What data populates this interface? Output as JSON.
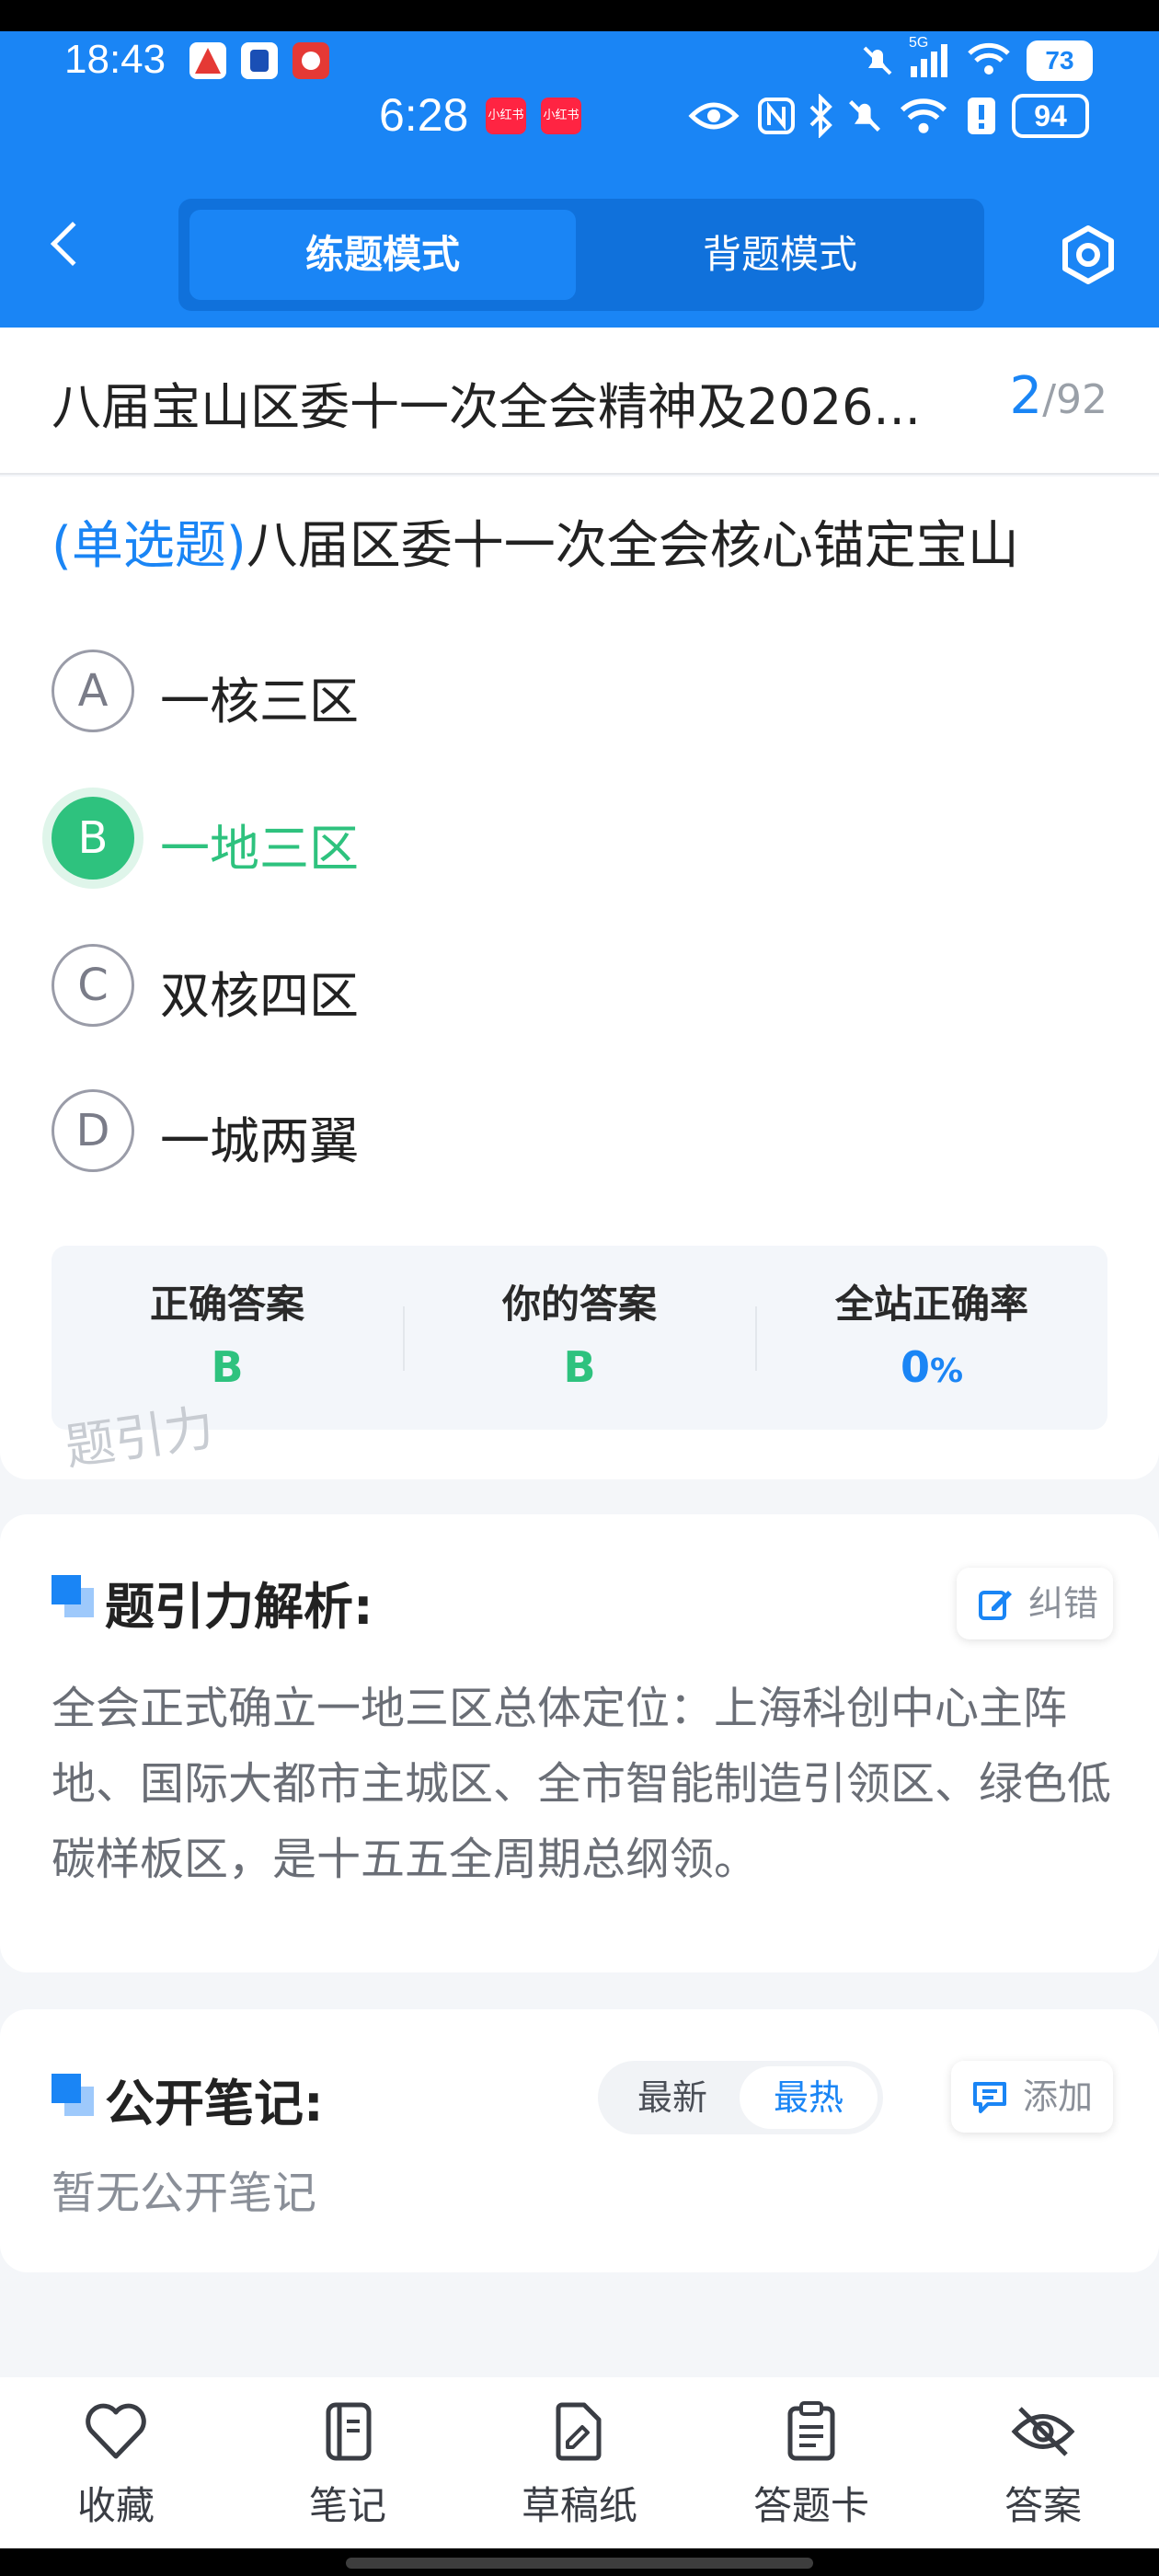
{
  "status_bar": {
    "time_primary": "18:43",
    "time_secondary": "6:28",
    "battery_primary": "73",
    "battery_secondary": "94",
    "network_label": "5G",
    "xhs_label": "小红书"
  },
  "nav": {
    "tab_practice": "练题模式",
    "tab_memorize": "背题模式"
  },
  "header": {
    "title": "八届宝山区委十一次全会精神及2026...",
    "current": "2",
    "total": "/92"
  },
  "question": {
    "type_label": "(单选题)",
    "text": "八届区委十一次全会核心锚定宝山",
    "options": [
      {
        "letter": "A",
        "text": "一核三区"
      },
      {
        "letter": "B",
        "text": "一地三区"
      },
      {
        "letter": "C",
        "text": "双核四区"
      },
      {
        "letter": "D",
        "text": "一城两翼"
      }
    ],
    "selected": "B"
  },
  "result": {
    "correct_label": "正确答案",
    "correct_value": "B",
    "yours_label": "你的答案",
    "yours_value": "B",
    "rate_label": "全站正确率",
    "rate_value": "0",
    "rate_unit": "%",
    "watermark": "题引力"
  },
  "analysis": {
    "title": "题引力解析:",
    "correct_button": "纠错",
    "body": "全会正式确立一地三区总体定位：上海科创中心主阵地、国际大都市主城区、全市智能制造引领区、绿色低碳样板区，是十五五全周期总纲领。"
  },
  "notes": {
    "title": "公开笔记:",
    "sort_latest": "最新",
    "sort_hot": "最热",
    "add_button": "添加",
    "empty_text": "暂无公开笔记"
  },
  "bottom_tabs": [
    {
      "label": "收藏",
      "icon": "heart-icon"
    },
    {
      "label": "笔记",
      "icon": "notebook-icon"
    },
    {
      "label": "草稿纸",
      "icon": "draft-icon"
    },
    {
      "label": "答题卡",
      "icon": "answer-card-icon"
    },
    {
      "label": "答案",
      "icon": "eye-off-icon"
    }
  ],
  "colors": {
    "brand_blue": "#1a85f5",
    "correct_green": "#2ec27e"
  }
}
